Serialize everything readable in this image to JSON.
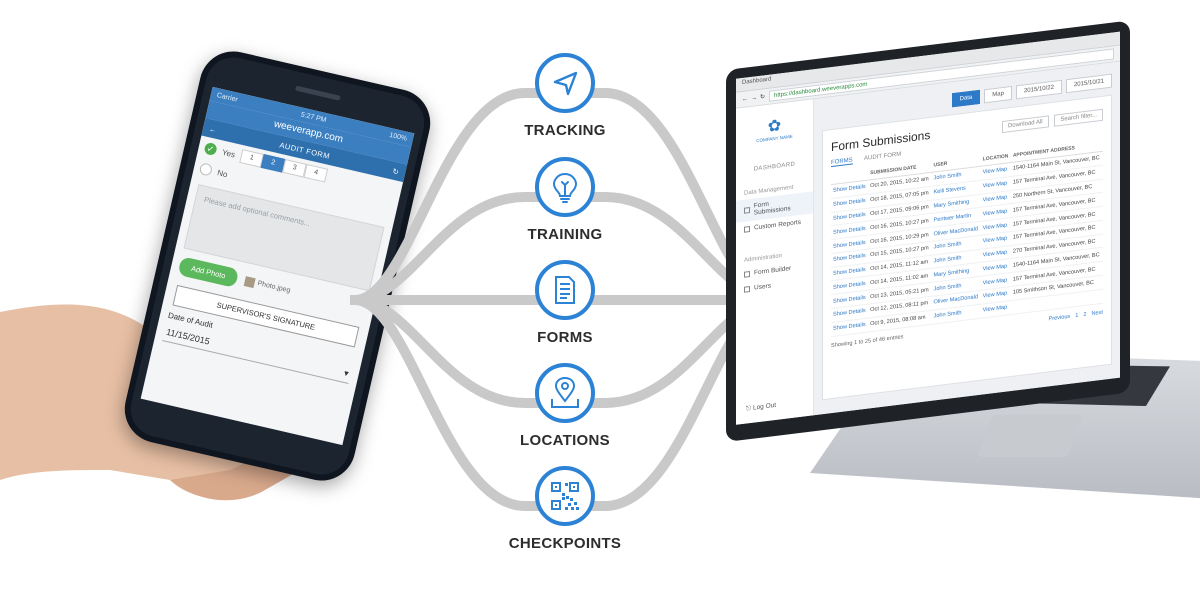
{
  "features": {
    "items": [
      {
        "label": "TRACKING",
        "icon": "navigation-arrow-icon"
      },
      {
        "label": "TRAINING",
        "icon": "lightbulb-icon"
      },
      {
        "label": "FORMS",
        "icon": "document-icon"
      },
      {
        "label": "LOCATIONS",
        "icon": "map-pin-icon"
      },
      {
        "label": "CHECKPOINTS",
        "icon": "qr-code-icon"
      }
    ],
    "accent_color": "#2c83d6",
    "connector_color": "#c9c9c9"
  },
  "phone": {
    "status": {
      "carrier": "Carrier",
      "time": "5:27 PM",
      "battery": "100%"
    },
    "url": "weeverapp.com",
    "form_title": "AUDIT FORM",
    "yes_label": "Yes",
    "no_label": "No",
    "scale": [
      "1",
      "2",
      "3",
      "4"
    ],
    "selected_scale": "2",
    "comments_placeholder": "Please add optional comments...",
    "add_photo": "Add Photo",
    "photo_filename": "Photo.jpeg",
    "signature_button": "SUPERVISOR'S SIGNATURE",
    "date_label": "Date of Audit",
    "date_value": "11/15/2015"
  },
  "laptop": {
    "tab_title": "Dashboard",
    "address": "https://dashboard.weeverapps.com",
    "logo_text": "COMPANY NAME",
    "sidebar": {
      "dashboard": "DASHBOARD",
      "data_section": "Data Management",
      "items": [
        "Form Submissions",
        "Custom Reports"
      ],
      "admin_section": "Administration",
      "admin_items": [
        "Form Builder",
        "Users"
      ],
      "logout": "Log Out"
    },
    "topbar": {
      "data": "Data",
      "map": "Map",
      "date_from": "2015/10/22",
      "date_to": "2015/10/21"
    },
    "page_title": "Form Submissions",
    "tabs": [
      "FORMS",
      "AUDIT FORM"
    ],
    "download": "Download All",
    "search_placeholder": "Search filter...",
    "columns": [
      "",
      "SUBMISSION DATE",
      "USER",
      "LOCATION",
      "APPOINTMENT ADDRESS"
    ],
    "rows": [
      [
        "Show Details",
        "Oct 20, 2015, 10:22 am",
        "John Smith",
        "View Map",
        "1540-1164 Main St, Vancouver, BC"
      ],
      [
        "Show Details",
        "Oct 18, 2015, 07:05 pm",
        "Kelli Stevens",
        "View Map",
        "157 Terminal Ave, Vancouver, BC"
      ],
      [
        "Show Details",
        "Oct 17, 2015, 09:06 pm",
        "Mary Smithing",
        "View Map",
        "250 Northern St, Vancouver, BC"
      ],
      [
        "Show Details",
        "Oct 16, 2015, 10:27 pm",
        "Pentwer Martin",
        "View Map",
        "157 Terminal Ave, Vancouver, BC"
      ],
      [
        "Show Details",
        "Oct 16, 2015, 10:29 pm",
        "Oliver MacDonald",
        "View Map",
        "157 Terminal Ave, Vancouver, BC"
      ],
      [
        "Show Details",
        "Oct 15, 2015, 10:27 pm",
        "John Smith",
        "View Map",
        "157 Terminal Ave, Vancouver, BC"
      ],
      [
        "Show Details",
        "Oct 14, 2015, 11:12 am",
        "John Smith",
        "View Map",
        "270 Terminal Ave, Vancouver, BC"
      ],
      [
        "Show Details",
        "Oct 14, 2015, 11:02 am",
        "Mary Smithing",
        "View Map",
        "1540-1164 Main St, Vancouver, BC"
      ],
      [
        "Show Details",
        "Oct 13, 2015, 05:21 pm",
        "John Smith",
        "View Map",
        "157 Terminal Ave, Vancouver, BC"
      ],
      [
        "Show Details",
        "Oct 12, 2015, 08:11 pm",
        "Oliver MacDonald",
        "View Map",
        "105 Smithson St, Vancouver, BC"
      ],
      [
        "Show Details",
        "Oct 9, 2015, 08:08 am",
        "John Smith",
        "View Map",
        ""
      ]
    ],
    "footer": "Showing 1 to 25 of 46 entries",
    "pagination": [
      "Previous",
      "1",
      "2",
      "Next"
    ]
  }
}
